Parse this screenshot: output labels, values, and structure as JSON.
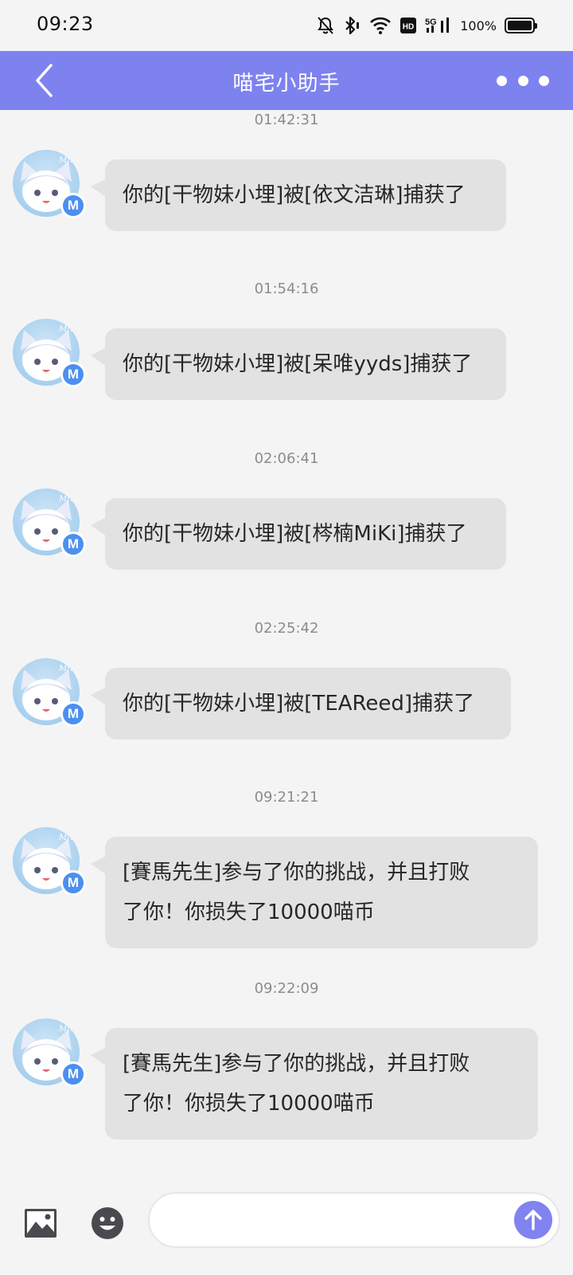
{
  "status_bar": {
    "time": "09:23",
    "battery_percent": "100%",
    "icons": [
      "mute-icon",
      "bluetooth-icon",
      "wifi-icon",
      "hd-icon",
      "5g-signal-icon",
      "battery-icon"
    ]
  },
  "nav": {
    "title": "喵宅小助手",
    "back_icon": "chevron-left-icon",
    "more_icon": "more-dots-icon",
    "bar_color": "#7d82ef"
  },
  "messages": [
    {
      "time": "01:42:31",
      "lines": [
        "你的[干物妹小埋]被[依文洁琳]捕获了"
      ]
    },
    {
      "time": "01:54:16",
      "lines": [
        "你的[干物妹小埋]被[呆唯yyds]捕获了"
      ]
    },
    {
      "time": "02:06:41",
      "lines": [
        "你的[干物妹小埋]被[梣楠MiKi]捕获了"
      ]
    },
    {
      "time": "02:25:42",
      "lines": [
        "你的[干物妹小埋]被[TEAReed]捕获了"
      ]
    },
    {
      "time": "09:21:21",
      "lines": [
        "[賽馬先生]参与了你的挑战，并且打败",
        "了你！你损失了10000喵币"
      ]
    },
    {
      "time": "09:22:09",
      "lines": [
        "[賽馬先生]参与了你的挑战，并且打败",
        "了你！你损失了10000喵币"
      ]
    }
  ],
  "avatar": {
    "badge_letter": "M",
    "watermark": "Mfuns"
  },
  "input_bar": {
    "input_value": "",
    "image_icon": "image-icon",
    "emoji_icon": "emoji-icon",
    "send_icon": "arrow-up-icon",
    "send_color": "#8083f0"
  }
}
